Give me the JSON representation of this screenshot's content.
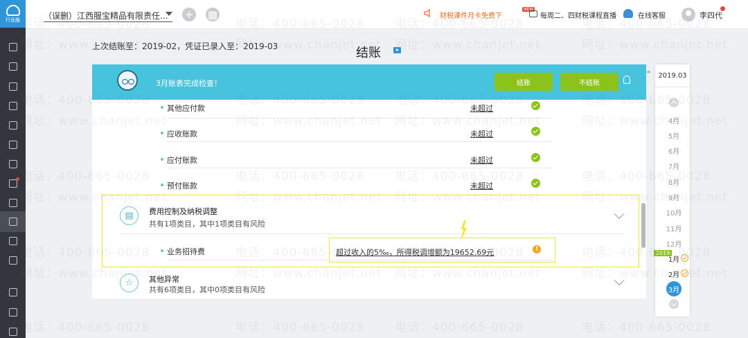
{
  "app": {
    "edition_label": "行业版"
  },
  "topbar": {
    "company": "（误删）江西服宝精品有限责任...",
    "promo": "财税课件月卡免费下",
    "live_badge": "NEW",
    "live": "每周二、四财税课程直播",
    "service": "在线客服",
    "username": "李四代"
  },
  "header": {
    "last_close": "上次结账至：2019-02，凭证已录入至：2019-03",
    "title": "结账"
  },
  "banner": {
    "text": "3月账表完成检查！",
    "close_button": "结账",
    "not_close_button": "不结账"
  },
  "check_rows": [
    {
      "label": "其他应付款",
      "status": "未超过"
    },
    {
      "label": "应收账款",
      "status": "未超过"
    },
    {
      "label": "应付账款",
      "status": "未超过"
    },
    {
      "label": "预付账款",
      "status": "未超过"
    }
  ],
  "sections": [
    {
      "title": "费用控制及纳税调整",
      "subtitle": "共有1项类目，其中1项类目有风险"
    },
    {
      "title": "其他异常",
      "subtitle": "共有6项类目，其中0项类目有风险"
    }
  ],
  "expense_row": {
    "label": "业务招待费",
    "warning": "超过收入的5‰，所得税调增额为19652.69元",
    "warning_icon": "!"
  },
  "rail": {
    "date": "2019.03",
    "collapse": "»",
    "months": [
      "4月",
      "5月",
      "6月",
      "7月",
      "8月",
      "9月",
      "10月",
      "11月",
      "12月",
      "1月",
      "2月",
      "3月"
    ],
    "year_badge": "2019"
  },
  "watermark": [
    "电话：400-665-0028",
    "网址：www.chanjet.net"
  ],
  "colors": {
    "accent": "#47c3de",
    "green": "#8bc31b",
    "highlight": "#f2e72b",
    "warn": "#f5a623"
  }
}
